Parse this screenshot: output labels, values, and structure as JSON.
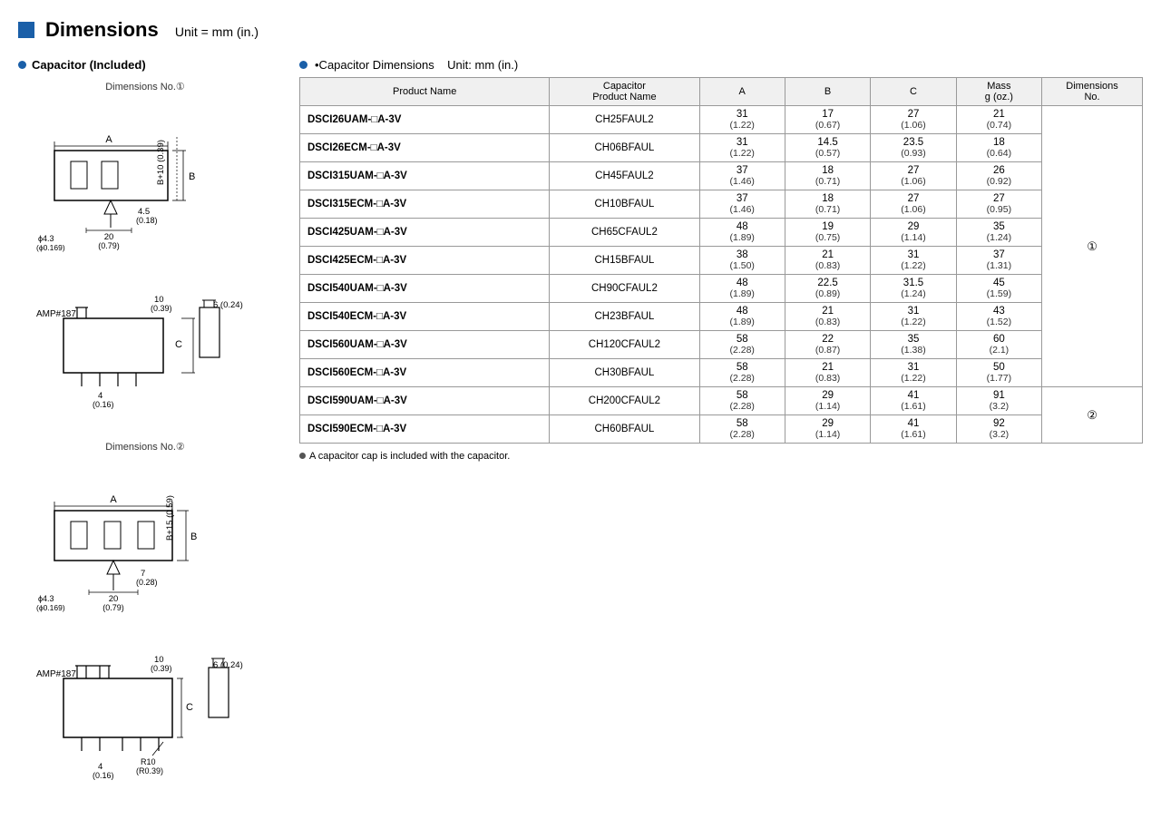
{
  "header": {
    "title": "Dimensions",
    "unit_text": "Unit = mm (in.)"
  },
  "left_panel": {
    "section_title": "Capacitor (Included)",
    "diagram1_label": "Dimensions No.①",
    "diagram2_label": "Dimensions No.②"
  },
  "right_panel": {
    "section_title": "•Capacitor Dimensions",
    "unit_text": "Unit: mm (in.)",
    "table": {
      "headers": [
        "Product Name",
        "Capacitor\nProduct Name",
        "A",
        "B",
        "C",
        "Mass\ng (oz.)",
        "Dimensions\nNo."
      ],
      "rows": [
        {
          "product": "DSCI26UAM-□A-3V",
          "cap_product": "CH25FAUL2",
          "A": [
            "31",
            "(1.22)"
          ],
          "B": [
            "17",
            "(0.67)"
          ],
          "C": [
            "27",
            "(1.06)"
          ],
          "mass": [
            "21",
            "(0.74)"
          ],
          "dimno": "①"
        },
        {
          "product": "DSCI26ECM-□A-3V",
          "cap_product": "CH06BFAUL",
          "A": [
            "31",
            "(1.22)"
          ],
          "B": [
            "14.5",
            "(0.57)"
          ],
          "C": [
            "23.5",
            "(0.93)"
          ],
          "mass": [
            "18",
            "(0.64)"
          ],
          "dimno": "①"
        },
        {
          "product": "DSCI315UAM-□A-3V",
          "cap_product": "CH45FAUL2",
          "A": [
            "37",
            "(1.46)"
          ],
          "B": [
            "18",
            "(0.71)"
          ],
          "C": [
            "27",
            "(1.06)"
          ],
          "mass": [
            "26",
            "(0.92)"
          ],
          "dimno": "①"
        },
        {
          "product": "DSCI315ECM-□A-3V",
          "cap_product": "CH10BFAUL",
          "A": [
            "37",
            "(1.46)"
          ],
          "B": [
            "18",
            "(0.71)"
          ],
          "C": [
            "27",
            "(1.06)"
          ],
          "mass": [
            "27",
            "(0.95)"
          ],
          "dimno": "①"
        },
        {
          "product": "DSCI425UAM-□A-3V",
          "cap_product": "CH65CFAUL2",
          "A": [
            "48",
            "(1.89)"
          ],
          "B": [
            "19",
            "(0.75)"
          ],
          "C": [
            "29",
            "(1.14)"
          ],
          "mass": [
            "35",
            "(1.24)"
          ],
          "dimno": "①"
        },
        {
          "product": "DSCI425ECM-□A-3V",
          "cap_product": "CH15BFAUL",
          "A": [
            "38",
            "(1.50)"
          ],
          "B": [
            "21",
            "(0.83)"
          ],
          "C": [
            "31",
            "(1.22)"
          ],
          "mass": [
            "37",
            "(1.31)"
          ],
          "dimno": "①"
        },
        {
          "product": "DSCI540UAM-□A-3V",
          "cap_product": "CH90CFAUL2",
          "A": [
            "48",
            "(1.89)"
          ],
          "B": [
            "22.5",
            "(0.89)"
          ],
          "C": [
            "31.5",
            "(1.24)"
          ],
          "mass": [
            "45",
            "(1.59)"
          ],
          "dimno": "①"
        },
        {
          "product": "DSCI540ECM-□A-3V",
          "cap_product": "CH23BFAUL",
          "A": [
            "48",
            "(1.89)"
          ],
          "B": [
            "21",
            "(0.83)"
          ],
          "C": [
            "31",
            "(1.22)"
          ],
          "mass": [
            "43",
            "(1.52)"
          ],
          "dimno": "①"
        },
        {
          "product": "DSCI560UAM-□A-3V",
          "cap_product": "CH120CFAUL2",
          "A": [
            "58",
            "(2.28)"
          ],
          "B": [
            "22",
            "(0.87)"
          ],
          "C": [
            "35",
            "(1.38)"
          ],
          "mass": [
            "60",
            "(2.1)"
          ],
          "dimno": "①"
        },
        {
          "product": "DSCI560ECM-□A-3V",
          "cap_product": "CH30BFAUL",
          "A": [
            "58",
            "(2.28)"
          ],
          "B": [
            "21",
            "(0.83)"
          ],
          "C": [
            "31",
            "(1.22)"
          ],
          "mass": [
            "50",
            "(1.77)"
          ],
          "dimno": "①"
        },
        {
          "product": "DSCI590UAM-□A-3V",
          "cap_product": "CH200CFAUL2",
          "A": [
            "58",
            "(2.28)"
          ],
          "B": [
            "29",
            "(1.14)"
          ],
          "C": [
            "41",
            "(1.61)"
          ],
          "mass": [
            "91",
            "(3.2)"
          ],
          "dimno": "②"
        },
        {
          "product": "DSCI590ECM-□A-3V",
          "cap_product": "CH60BFAUL",
          "A": [
            "58",
            "(2.28)"
          ],
          "B": [
            "29",
            "(1.14)"
          ],
          "C": [
            "41",
            "(1.61)"
          ],
          "mass": [
            "92",
            "(3.2)"
          ],
          "dimno": "②"
        }
      ]
    },
    "footnote": "A capacitor cap is included with the capacitor."
  }
}
